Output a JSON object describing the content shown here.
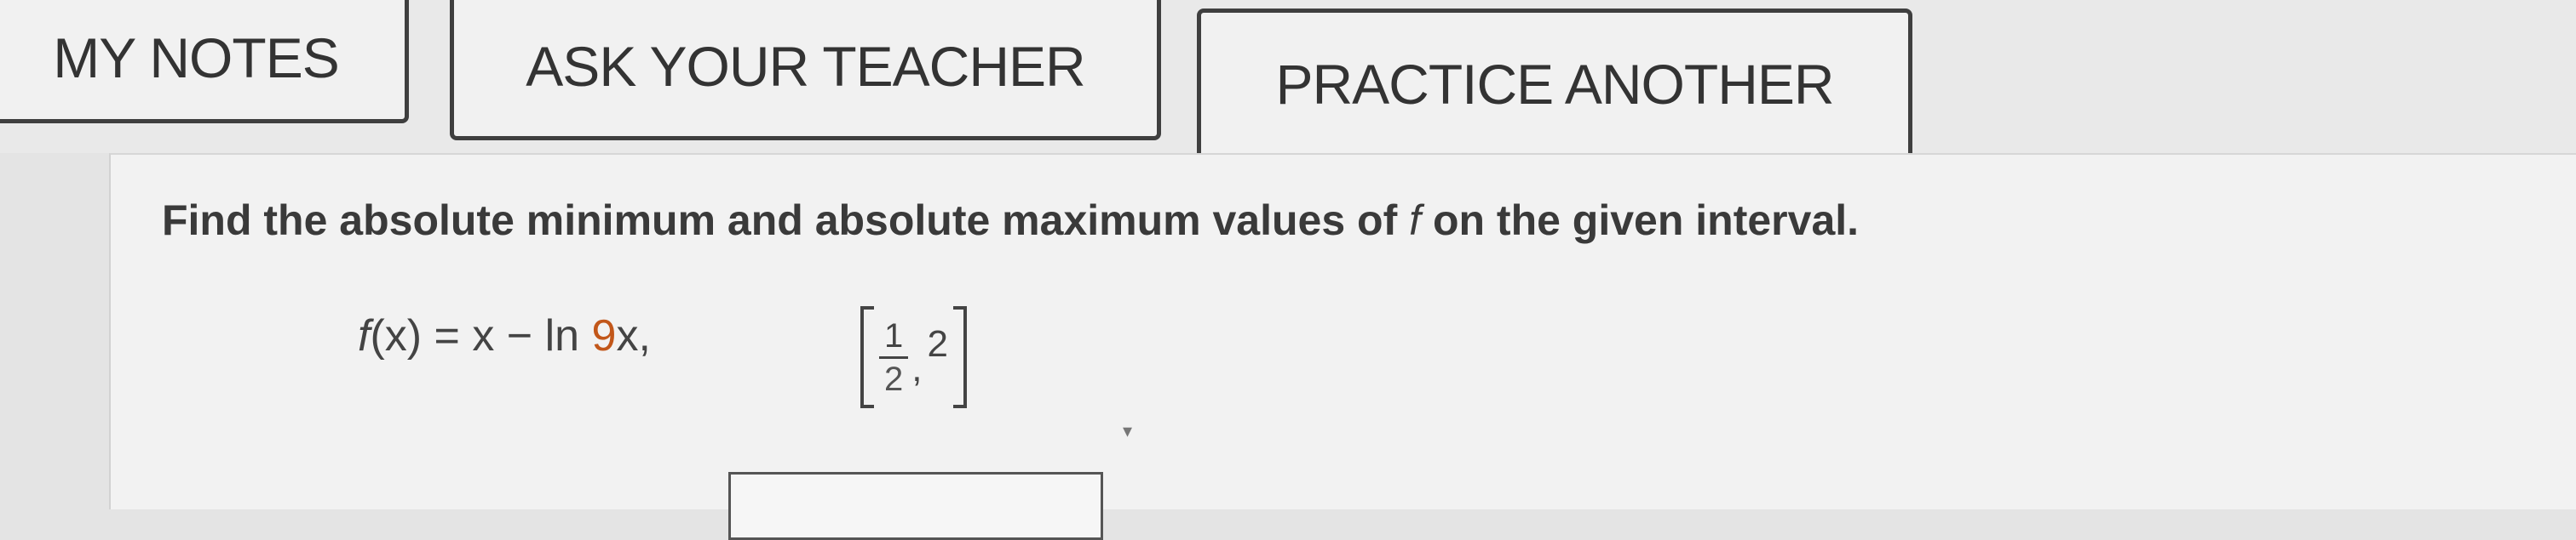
{
  "toolbar": {
    "my_notes_label": "MY NOTES",
    "ask_teacher_label": "ASK YOUR TEACHER",
    "practice_another_label": "PRACTICE ANOTHER"
  },
  "question": {
    "prompt_before": "Find the absolute minimum and absolute maximum values of ",
    "prompt_fn": "f",
    "prompt_after": " on the given interval.",
    "formula": {
      "fname": "f",
      "lhs_rest": "(x) = x − ln ",
      "coefficient": "9",
      "rhs_rest": "x,"
    },
    "interval": {
      "lower_numerator": "1",
      "lower_denominator": "2",
      "separator": ",",
      "upper": "2"
    },
    "tail_mark": "▾"
  },
  "colors": {
    "coefficient": "#c2571a",
    "border": "#3f3f3f"
  }
}
